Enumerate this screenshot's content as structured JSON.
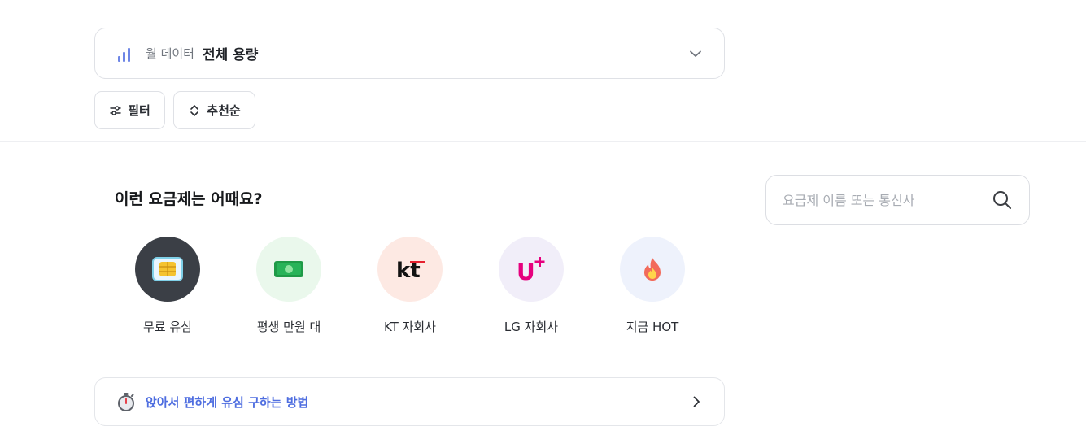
{
  "data_select": {
    "label": "월 데이터",
    "value": "전체 용량",
    "accent_color": "#6e86e6"
  },
  "chips": {
    "filter_label": "필터",
    "sort_label": "추천순"
  },
  "recommend": {
    "title": "이런 요금제는 어때요?"
  },
  "search": {
    "placeholder": "요금제 이름 또는 통신사"
  },
  "categories": [
    {
      "label": "무료 유심",
      "icon": "sim-card-icon",
      "bg": "#3b3f46"
    },
    {
      "label": "평생 만원 대",
      "icon": "cash-icon",
      "bg": "#eaf8ec"
    },
    {
      "label": "KT 자회사",
      "icon": "kt-logo-icon",
      "bg": "#fde9e3",
      "logo_text": "kt"
    },
    {
      "label": "LG 자회사",
      "icon": "lg-uplus-logo-icon",
      "bg": "#f1eef9",
      "logo_text": "U"
    },
    {
      "label": "지금 HOT",
      "icon": "fire-icon",
      "bg": "#eef2fc"
    }
  ],
  "guide": {
    "text": "앉아서 편하게 유심 구하는 방법",
    "color": "#4f6ee0"
  }
}
